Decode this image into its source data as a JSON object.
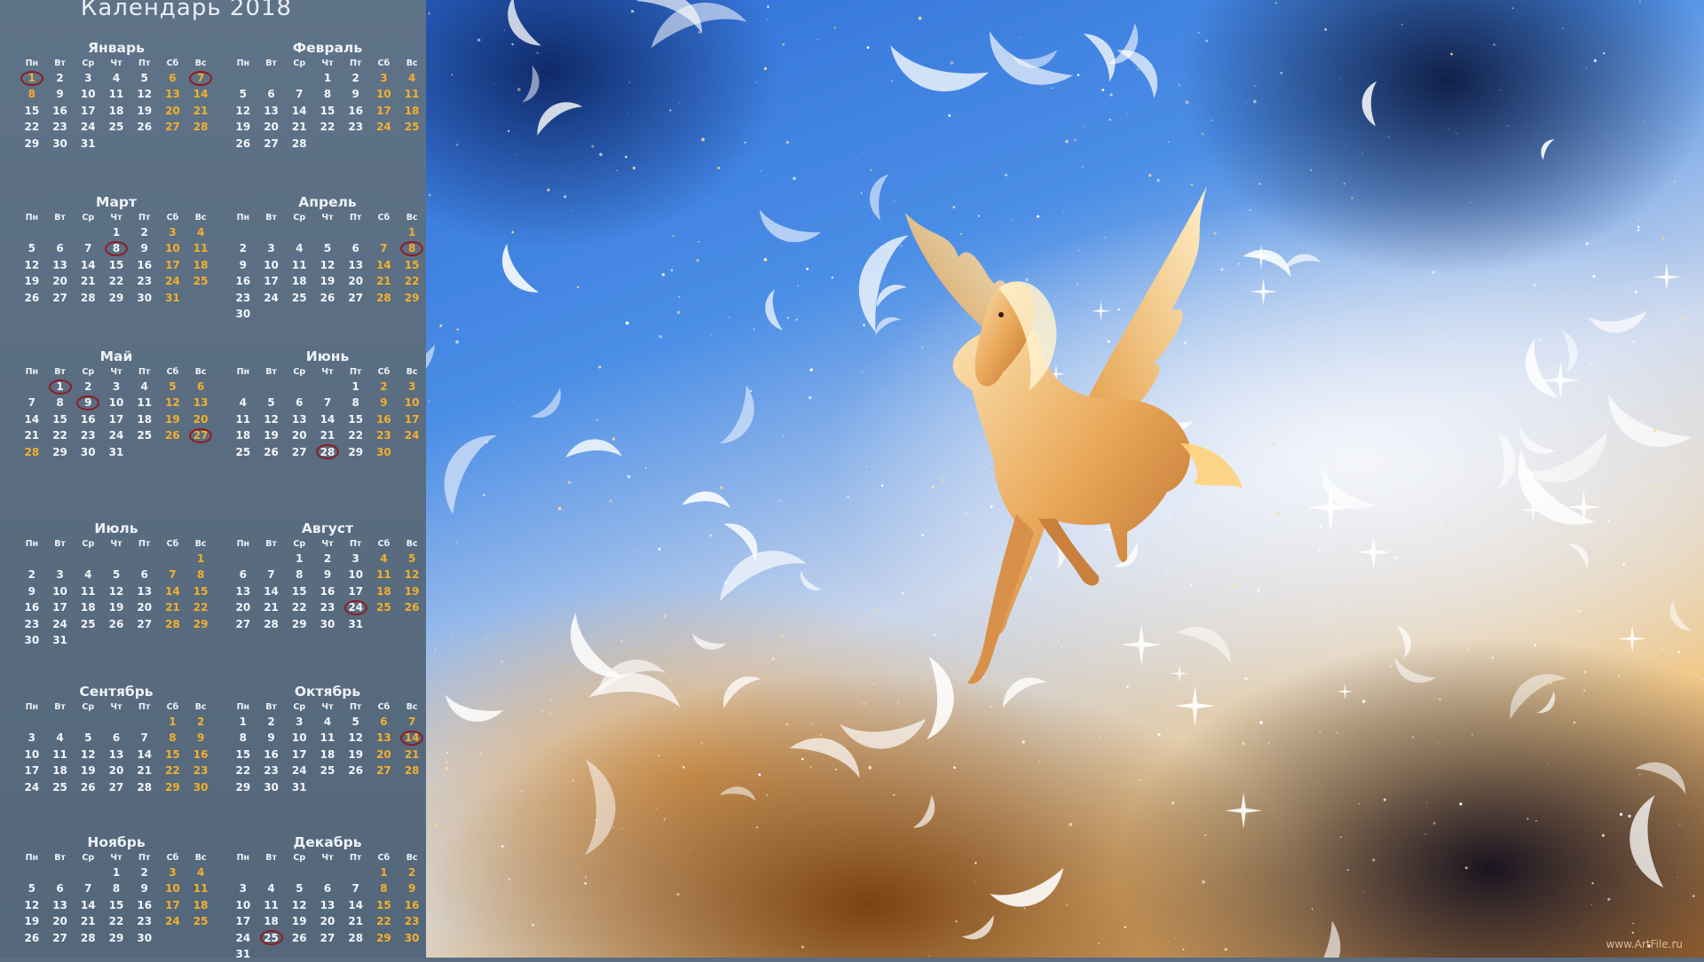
{
  "title": "Календарь 2018",
  "weekday_headers": [
    "Пн",
    "Вт",
    "Ср",
    "Чт",
    "Пт",
    "Сб",
    "Вс"
  ],
  "months": [
    {
      "name": "Январь",
      "weeks": [
        [
          "1",
          "2",
          "3",
          "4",
          "5",
          "6",
          "7"
        ],
        [
          "8",
          "9",
          "10",
          "11",
          "12",
          "13",
          "14"
        ],
        [
          "15",
          "16",
          "17",
          "18",
          "19",
          "20",
          "21"
        ],
        [
          "22",
          "23",
          "24",
          "25",
          "26",
          "27",
          "28"
        ],
        [
          "29",
          "30",
          "31",
          "",
          "",
          "",
          ""
        ]
      ],
      "holidays": [
        "1",
        "8"
      ],
      "circled": [
        "1",
        "7"
      ]
    },
    {
      "name": "Февраль",
      "weeks": [
        [
          "",
          "",
          "",
          "1",
          "2",
          "3",
          "4"
        ],
        [
          "5",
          "6",
          "7",
          "8",
          "9",
          "10",
          "11"
        ],
        [
          "12",
          "13",
          "14",
          "15",
          "16",
          "17",
          "18"
        ],
        [
          "19",
          "20",
          "21",
          "22",
          "23",
          "24",
          "25"
        ],
        [
          "26",
          "27",
          "28",
          "",
          "",
          "",
          ""
        ]
      ],
      "holidays": [],
      "circled": []
    },
    {
      "name": "Март",
      "weeks": [
        [
          "",
          "",
          "",
          "1",
          "2",
          "3",
          "4"
        ],
        [
          "5",
          "6",
          "7",
          "8",
          "9",
          "10",
          "11"
        ],
        [
          "12",
          "13",
          "14",
          "15",
          "16",
          "17",
          "18"
        ],
        [
          "19",
          "20",
          "21",
          "22",
          "23",
          "24",
          "25"
        ],
        [
          "26",
          "27",
          "28",
          "29",
          "30",
          "31",
          ""
        ]
      ],
      "holidays": [],
      "circled": [
        "8"
      ]
    },
    {
      "name": "Апрель",
      "weeks": [
        [
          "",
          "",
          "",
          "",
          "",
          "",
          "1"
        ],
        [
          "2",
          "3",
          "4",
          "5",
          "6",
          "7",
          "8"
        ],
        [
          "9",
          "10",
          "11",
          "12",
          "13",
          "14",
          "15"
        ],
        [
          "16",
          "17",
          "18",
          "19",
          "20",
          "21",
          "22"
        ],
        [
          "23",
          "24",
          "25",
          "26",
          "27",
          "28",
          "29"
        ],
        [
          "30",
          "",
          "",
          "",
          "",
          "",
          ""
        ]
      ],
      "holidays": [],
      "circled": [
        "8"
      ]
    },
    {
      "name": "Май",
      "weeks": [
        [
          "",
          "1",
          "2",
          "3",
          "4",
          "5",
          "6"
        ],
        [
          "7",
          "8",
          "9",
          "10",
          "11",
          "12",
          "13"
        ],
        [
          "14",
          "15",
          "16",
          "17",
          "18",
          "19",
          "20"
        ],
        [
          "21",
          "22",
          "23",
          "24",
          "25",
          "26",
          "27"
        ],
        [
          "28",
          "29",
          "30",
          "31",
          "",
          "",
          ""
        ]
      ],
      "holidays": [
        "28"
      ],
      "circled": [
        "1",
        "9",
        "27"
      ]
    },
    {
      "name": "Июнь",
      "weeks": [
        [
          "",
          "",
          "",
          "",
          "1",
          "2",
          "3"
        ],
        [
          "4",
          "5",
          "6",
          "7",
          "8",
          "9",
          "10"
        ],
        [
          "11",
          "12",
          "13",
          "14",
          "15",
          "16",
          "17"
        ],
        [
          "18",
          "19",
          "20",
          "21",
          "22",
          "23",
          "24"
        ],
        [
          "25",
          "26",
          "27",
          "28",
          "29",
          "30",
          ""
        ]
      ],
      "holidays": [],
      "circled": [
        "28"
      ]
    },
    {
      "name": "Июль",
      "weeks": [
        [
          "",
          "",
          "",
          "",
          "",
          "",
          "1"
        ],
        [
          "2",
          "3",
          "4",
          "5",
          "6",
          "7",
          "8"
        ],
        [
          "9",
          "10",
          "11",
          "12",
          "13",
          "14",
          "15"
        ],
        [
          "16",
          "17",
          "18",
          "19",
          "20",
          "21",
          "22"
        ],
        [
          "23",
          "24",
          "25",
          "26",
          "27",
          "28",
          "29"
        ],
        [
          "30",
          "31",
          "",
          "",
          "",
          "",
          ""
        ]
      ],
      "holidays": [],
      "circled": []
    },
    {
      "name": "Август",
      "weeks": [
        [
          "",
          "",
          "1",
          "2",
          "3",
          "4",
          "5"
        ],
        [
          "6",
          "7",
          "8",
          "9",
          "10",
          "11",
          "12"
        ],
        [
          "13",
          "14",
          "15",
          "16",
          "17",
          "18",
          "19"
        ],
        [
          "20",
          "21",
          "22",
          "23",
          "24",
          "25",
          "26"
        ],
        [
          "27",
          "28",
          "29",
          "30",
          "31",
          "",
          ""
        ]
      ],
      "holidays": [],
      "circled": [
        "24"
      ]
    },
    {
      "name": "Сентябрь",
      "weeks": [
        [
          "",
          "",
          "",
          "",
          "",
          "1",
          "2"
        ],
        [
          "3",
          "4",
          "5",
          "6",
          "7",
          "8",
          "9"
        ],
        [
          "10",
          "11",
          "12",
          "13",
          "14",
          "15",
          "16"
        ],
        [
          "17",
          "18",
          "19",
          "20",
          "21",
          "22",
          "23"
        ],
        [
          "24",
          "25",
          "26",
          "27",
          "28",
          "29",
          "30"
        ]
      ],
      "holidays": [],
      "circled": []
    },
    {
      "name": "Октябрь",
      "weeks": [
        [
          "1",
          "2",
          "3",
          "4",
          "5",
          "6",
          "7"
        ],
        [
          "8",
          "9",
          "10",
          "11",
          "12",
          "13",
          "14"
        ],
        [
          "15",
          "16",
          "17",
          "18",
          "19",
          "20",
          "21"
        ],
        [
          "22",
          "23",
          "24",
          "25",
          "26",
          "27",
          "28"
        ],
        [
          "29",
          "30",
          "31",
          "",
          "",
          "",
          ""
        ]
      ],
      "holidays": [],
      "circled": [
        "14"
      ]
    },
    {
      "name": "Ноябрь",
      "weeks": [
        [
          "",
          "",
          "",
          "1",
          "2",
          "3",
          "4"
        ],
        [
          "5",
          "6",
          "7",
          "8",
          "9",
          "10",
          "11"
        ],
        [
          "12",
          "13",
          "14",
          "15",
          "16",
          "17",
          "18"
        ],
        [
          "19",
          "20",
          "21",
          "22",
          "23",
          "24",
          "25"
        ],
        [
          "26",
          "27",
          "28",
          "29",
          "30",
          "",
          ""
        ]
      ],
      "holidays": [],
      "circled": []
    },
    {
      "name": "Декабрь",
      "weeks": [
        [
          "",
          "",
          "",
          "",
          "",
          "1",
          "2"
        ],
        [
          "3",
          "4",
          "5",
          "6",
          "7",
          "8",
          "9"
        ],
        [
          "10",
          "11",
          "12",
          "13",
          "14",
          "15",
          "16"
        ],
        [
          "17",
          "18",
          "19",
          "20",
          "21",
          "22",
          "23"
        ],
        [
          "24",
          "25",
          "26",
          "27",
          "28",
          "29",
          "30"
        ],
        [
          "31",
          "",
          "",
          "",
          "",
          "",
          ""
        ]
      ],
      "holidays": [],
      "circled": [
        "25"
      ]
    }
  ],
  "colors": {
    "panel": "#5a6d82",
    "weekday": "#f2f5f8",
    "weekend": "#f3b02c",
    "circle": "#8c1d22"
  },
  "watermark": "www.ArtFile.ru",
  "image": {
    "subject": "pegasus-icon"
  }
}
